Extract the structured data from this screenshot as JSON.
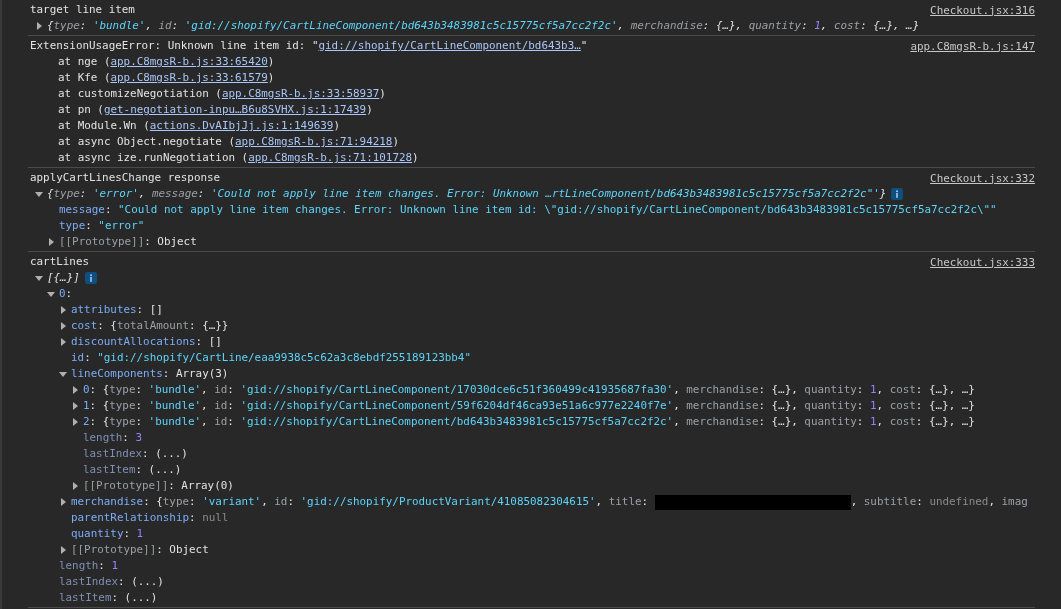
{
  "messages": [
    {
      "header": [
        {
          "kind": "plain",
          "text": "target line item"
        }
      ],
      "source": "Checkout.jsx:316",
      "tree": [
        {
          "kind": "preview",
          "expanded": false,
          "segments": [
            {
              "kind": "plain",
              "text": "{"
            },
            {
              "kind": "dimkey",
              "text": "type"
            },
            {
              "kind": "plain",
              "text": ": "
            },
            {
              "kind": "string",
              "text": "'bundle'"
            },
            {
              "kind": "plain",
              "text": ", "
            },
            {
              "kind": "dimkey",
              "text": "id"
            },
            {
              "kind": "plain",
              "text": ": "
            },
            {
              "kind": "string",
              "text": "'gid://shopify/CartLineComponent/bd643b3483981c5c15775cf5a7cc2f2c'"
            },
            {
              "kind": "plain",
              "text": ", "
            },
            {
              "kind": "dimkey",
              "text": "merchandise"
            },
            {
              "kind": "plain",
              "text": ": {…}, "
            },
            {
              "kind": "dimkey",
              "text": "quantity"
            },
            {
              "kind": "plain",
              "text": ": "
            },
            {
              "kind": "number",
              "text": "1"
            },
            {
              "kind": "plain",
              "text": ", "
            },
            {
              "kind": "dimkey",
              "text": "cost"
            },
            {
              "kind": "plain",
              "text": ": {…}, …}"
            }
          ]
        }
      ]
    },
    {
      "header": [
        {
          "kind": "plain",
          "text": "ExtensionUsageError: Unknown line item id: \""
        },
        {
          "kind": "link",
          "text": "gid://shopify/CartLineComponent/bd643b3…"
        },
        {
          "kind": "plain",
          "text": "\""
        }
      ],
      "source": "app.C8mgsR-b.js:147",
      "stack": [
        [
          {
            "kind": "plain",
            "text": "at nge ("
          },
          {
            "kind": "link",
            "text": "app.C8mgsR-b.js:33:65420"
          },
          {
            "kind": "plain",
            "text": ")"
          }
        ],
        [
          {
            "kind": "plain",
            "text": "at Kfe ("
          },
          {
            "kind": "link",
            "text": "app.C8mgsR-b.js:33:61579"
          },
          {
            "kind": "plain",
            "text": ")"
          }
        ],
        [
          {
            "kind": "plain",
            "text": "at customizeNegotiation ("
          },
          {
            "kind": "link",
            "text": "app.C8mgsR-b.js:33:58937"
          },
          {
            "kind": "plain",
            "text": ")"
          }
        ],
        [
          {
            "kind": "plain",
            "text": "at pn ("
          },
          {
            "kind": "link",
            "text": "get-negotiation-inpu…B6u8SVHX.js:1:17439"
          },
          {
            "kind": "plain",
            "text": ")"
          }
        ],
        [
          {
            "kind": "plain",
            "text": "at Module.Wn ("
          },
          {
            "kind": "link",
            "text": "actions.DvAIbjJj.js:1:149639"
          },
          {
            "kind": "plain",
            "text": ")"
          }
        ],
        [
          {
            "kind": "plain",
            "text": "at async Object.negotiate ("
          },
          {
            "kind": "link",
            "text": "app.C8mgsR-b.js:71:94218"
          },
          {
            "kind": "plain",
            "text": ")"
          }
        ],
        [
          {
            "kind": "plain",
            "text": "at async ize.runNegotiation ("
          },
          {
            "kind": "link",
            "text": "app.C8mgsR-b.js:71:101728"
          },
          {
            "kind": "plain",
            "text": ")"
          }
        ]
      ]
    },
    {
      "header": [
        {
          "kind": "plain",
          "text": "applyCartLinesChange response"
        }
      ],
      "source": "Checkout.jsx:332",
      "tree": [
        {
          "kind": "preview",
          "expanded": true,
          "info": true,
          "segments": [
            {
              "kind": "plain",
              "text": "{"
            },
            {
              "kind": "dimkey",
              "text": "type"
            },
            {
              "kind": "plain",
              "text": ": "
            },
            {
              "kind": "string",
              "text": "'error'"
            },
            {
              "kind": "plain",
              "text": ", "
            },
            {
              "kind": "dimkey",
              "text": "message"
            },
            {
              "kind": "plain",
              "text": ": "
            },
            {
              "kind": "string",
              "text": "'Could not apply line item changes. Error: Unknown …rtLineComponent/bd643b3483981c5c15775cf5a7cc2f2c\"'"
            },
            {
              "kind": "plain",
              "text": "}"
            }
          ],
          "children": [
            {
              "kind": "entry",
              "segments": [
                {
                  "kind": "key",
                  "text": "message"
                },
                {
                  "kind": "plain",
                  "text": ": "
                },
                {
                  "kind": "string",
                  "text": "\"Could not apply line item changes. Error: Unknown line item id: \\\"gid://shopify/CartLineComponent/bd643b3483981c5c15775cf5a7cc2f2c\\\"\""
                }
              ]
            },
            {
              "kind": "entry",
              "segments": [
                {
                  "kind": "key",
                  "text": "type"
                },
                {
                  "kind": "plain",
                  "text": ": "
                },
                {
                  "kind": "string",
                  "text": "\"error\""
                }
              ]
            },
            {
              "kind": "entry",
              "expanded": false,
              "segments": [
                {
                  "kind": "dimkey",
                  "text": "[[Prototype]]"
                },
                {
                  "kind": "plain",
                  "text": ": Object"
                }
              ]
            }
          ]
        }
      ]
    },
    {
      "header": [
        {
          "kind": "plain",
          "text": "cartLines"
        }
      ],
      "source": "Checkout.jsx:333",
      "tree": [
        {
          "kind": "preview",
          "expanded": true,
          "info": true,
          "segments": [
            {
              "kind": "plain",
              "text": "[{…}]"
            }
          ],
          "children": [
            {
              "kind": "entry",
              "expanded": true,
              "segments": [
                {
                  "kind": "key",
                  "text": "0"
                },
                {
                  "kind": "plain",
                  "text": ":"
                }
              ],
              "children": [
                {
                  "kind": "entry",
                  "expanded": false,
                  "segments": [
                    {
                      "kind": "key",
                      "text": "attributes"
                    },
                    {
                      "kind": "plain",
                      "text": ": []"
                    }
                  ]
                },
                {
                  "kind": "entry",
                  "expanded": false,
                  "segments": [
                    {
                      "kind": "key",
                      "text": "cost"
                    },
                    {
                      "kind": "plain",
                      "text": ": {"
                    },
                    {
                      "kind": "dimkey",
                      "text": "totalAmount"
                    },
                    {
                      "kind": "plain",
                      "text": ": {…}}"
                    }
                  ]
                },
                {
                  "kind": "entry",
                  "expanded": false,
                  "segments": [
                    {
                      "kind": "key",
                      "text": "discountAllocations"
                    },
                    {
                      "kind": "plain",
                      "text": ": []"
                    }
                  ]
                },
                {
                  "kind": "entry",
                  "segments": [
                    {
                      "kind": "key",
                      "text": "id"
                    },
                    {
                      "kind": "plain",
                      "text": ": "
                    },
                    {
                      "kind": "string",
                      "text": "\"gid://shopify/CartLine/eaa9938c5c62a3c8ebdf255189123bb4\""
                    }
                  ]
                },
                {
                  "kind": "entry",
                  "expanded": true,
                  "segments": [
                    {
                      "kind": "key",
                      "text": "lineComponents"
                    },
                    {
                      "kind": "plain",
                      "text": ": Array(3)"
                    }
                  ],
                  "children": [
                    {
                      "kind": "entry",
                      "expanded": false,
                      "segments": [
                        {
                          "kind": "key",
                          "text": "0"
                        },
                        {
                          "kind": "plain",
                          "text": ": {"
                        },
                        {
                          "kind": "dimkey",
                          "text": "type"
                        },
                        {
                          "kind": "plain",
                          "text": ": "
                        },
                        {
                          "kind": "string",
                          "text": "'bundle'"
                        },
                        {
                          "kind": "plain",
                          "text": ", "
                        },
                        {
                          "kind": "dimkey",
                          "text": "id"
                        },
                        {
                          "kind": "plain",
                          "text": ": "
                        },
                        {
                          "kind": "string",
                          "text": "'gid://shopify/CartLineComponent/17030dce6c51f360499c41935687fa30'"
                        },
                        {
                          "kind": "plain",
                          "text": ", "
                        },
                        {
                          "kind": "dimkey",
                          "text": "merchandise"
                        },
                        {
                          "kind": "plain",
                          "text": ": {…}, "
                        },
                        {
                          "kind": "dimkey",
                          "text": "quantity"
                        },
                        {
                          "kind": "plain",
                          "text": ": "
                        },
                        {
                          "kind": "number",
                          "text": "1"
                        },
                        {
                          "kind": "plain",
                          "text": ", "
                        },
                        {
                          "kind": "dimkey",
                          "text": "cost"
                        },
                        {
                          "kind": "plain",
                          "text": ": {…}, …}"
                        }
                      ]
                    },
                    {
                      "kind": "entry",
                      "expanded": false,
                      "segments": [
                        {
                          "kind": "key",
                          "text": "1"
                        },
                        {
                          "kind": "plain",
                          "text": ": {"
                        },
                        {
                          "kind": "dimkey",
                          "text": "type"
                        },
                        {
                          "kind": "plain",
                          "text": ": "
                        },
                        {
                          "kind": "string",
                          "text": "'bundle'"
                        },
                        {
                          "kind": "plain",
                          "text": ", "
                        },
                        {
                          "kind": "dimkey",
                          "text": "id"
                        },
                        {
                          "kind": "plain",
                          "text": ": "
                        },
                        {
                          "kind": "string",
                          "text": "'gid://shopify/CartLineComponent/59f6204df46ca93e51a6c977e2240f7e'"
                        },
                        {
                          "kind": "plain",
                          "text": ", "
                        },
                        {
                          "kind": "dimkey",
                          "text": "merchandise"
                        },
                        {
                          "kind": "plain",
                          "text": ": {…}, "
                        },
                        {
                          "kind": "dimkey",
                          "text": "quantity"
                        },
                        {
                          "kind": "plain",
                          "text": ": "
                        },
                        {
                          "kind": "number",
                          "text": "1"
                        },
                        {
                          "kind": "plain",
                          "text": ", "
                        },
                        {
                          "kind": "dimkey",
                          "text": "cost"
                        },
                        {
                          "kind": "plain",
                          "text": ": {…}, …}"
                        }
                      ]
                    },
                    {
                      "kind": "entry",
                      "expanded": false,
                      "segments": [
                        {
                          "kind": "key",
                          "text": "2"
                        },
                        {
                          "kind": "plain",
                          "text": ": {"
                        },
                        {
                          "kind": "dimkey",
                          "text": "type"
                        },
                        {
                          "kind": "plain",
                          "text": ": "
                        },
                        {
                          "kind": "string",
                          "text": "'bundle'"
                        },
                        {
                          "kind": "plain",
                          "text": ", "
                        },
                        {
                          "kind": "dimkey",
                          "text": "id"
                        },
                        {
                          "kind": "plain",
                          "text": ": "
                        },
                        {
                          "kind": "string",
                          "text": "'gid://shopify/CartLineComponent/bd643b3483981c5c15775cf5a7cc2f2c'"
                        },
                        {
                          "kind": "plain",
                          "text": ", "
                        },
                        {
                          "kind": "dimkey",
                          "text": "merchandise"
                        },
                        {
                          "kind": "plain",
                          "text": ": {…}, "
                        },
                        {
                          "kind": "dimkey",
                          "text": "quantity"
                        },
                        {
                          "kind": "plain",
                          "text": ": "
                        },
                        {
                          "kind": "number",
                          "text": "1"
                        },
                        {
                          "kind": "plain",
                          "text": ", "
                        },
                        {
                          "kind": "dimkey",
                          "text": "cost"
                        },
                        {
                          "kind": "plain",
                          "text": ": {…}, …}"
                        }
                      ]
                    },
                    {
                      "kind": "entry",
                      "segments": [
                        {
                          "kind": "innerkey",
                          "text": "length"
                        },
                        {
                          "kind": "plain",
                          "text": ": "
                        },
                        {
                          "kind": "number",
                          "text": "3"
                        }
                      ]
                    },
                    {
                      "kind": "entry",
                      "segments": [
                        {
                          "kind": "innerkey",
                          "text": "lastIndex"
                        },
                        {
                          "kind": "plain",
                          "text": ": (...)"
                        }
                      ]
                    },
                    {
                      "kind": "entry",
                      "segments": [
                        {
                          "kind": "innerkey",
                          "text": "lastItem"
                        },
                        {
                          "kind": "plain",
                          "text": ": (...)"
                        }
                      ]
                    },
                    {
                      "kind": "entry",
                      "expanded": false,
                      "segments": [
                        {
                          "kind": "dimkey",
                          "text": "[[Prototype]]"
                        },
                        {
                          "kind": "plain",
                          "text": ": Array(0)"
                        }
                      ]
                    }
                  ]
                },
                {
                  "kind": "entry",
                  "expanded": false,
                  "segments": [
                    {
                      "kind": "key",
                      "text": "merchandise"
                    },
                    {
                      "kind": "plain",
                      "text": ": {"
                    },
                    {
                      "kind": "dimkey",
                      "text": "type"
                    },
                    {
                      "kind": "plain",
                      "text": ": "
                    },
                    {
                      "kind": "string",
                      "text": "'variant'"
                    },
                    {
                      "kind": "plain",
                      "text": ", "
                    },
                    {
                      "kind": "dimkey",
                      "text": "id"
                    },
                    {
                      "kind": "plain",
                      "text": ": "
                    },
                    {
                      "kind": "string",
                      "text": "'gid://shopify/ProductVariant/41085082304615'"
                    },
                    {
                      "kind": "plain",
                      "text": ", "
                    },
                    {
                      "kind": "dimkey",
                      "text": "title"
                    },
                    {
                      "kind": "plain",
                      "text": ": "
                    },
                    {
                      "kind": "redacted"
                    },
                    {
                      "kind": "plain",
                      "text": ", "
                    },
                    {
                      "kind": "dimkey",
                      "text": "subtitle"
                    },
                    {
                      "kind": "plain",
                      "text": ": "
                    },
                    {
                      "kind": "null",
                      "text": "undefined"
                    },
                    {
                      "kind": "plain",
                      "text": ", "
                    },
                    {
                      "kind": "dimkey",
                      "text": "imag"
                    }
                  ]
                },
                {
                  "kind": "entry",
                  "segments": [
                    {
                      "kind": "key",
                      "text": "parentRelationship"
                    },
                    {
                      "kind": "plain",
                      "text": ": "
                    },
                    {
                      "kind": "null",
                      "text": "null"
                    }
                  ]
                },
                {
                  "kind": "entry",
                  "segments": [
                    {
                      "kind": "key",
                      "text": "quantity"
                    },
                    {
                      "kind": "plain",
                      "text": ": "
                    },
                    {
                      "kind": "number",
                      "text": "1"
                    }
                  ]
                },
                {
                  "kind": "entry",
                  "expanded": false,
                  "segments": [
                    {
                      "kind": "dimkey",
                      "text": "[[Prototype]]"
                    },
                    {
                      "kind": "plain",
                      "text": ": Object"
                    }
                  ]
                }
              ]
            },
            {
              "kind": "entry",
              "segments": [
                {
                  "kind": "innerkey",
                  "text": "length"
                },
                {
                  "kind": "plain",
                  "text": ": "
                },
                {
                  "kind": "number",
                  "text": "1"
                }
              ]
            },
            {
              "kind": "entry",
              "segments": [
                {
                  "kind": "innerkey",
                  "text": "lastIndex"
                },
                {
                  "kind": "plain",
                  "text": ": (...)"
                }
              ]
            },
            {
              "kind": "entry",
              "segments": [
                {
                  "kind": "innerkey",
                  "text": "lastItem"
                },
                {
                  "kind": "plain",
                  "text": ": (...)"
                }
              ]
            }
          ]
        }
      ]
    }
  ]
}
